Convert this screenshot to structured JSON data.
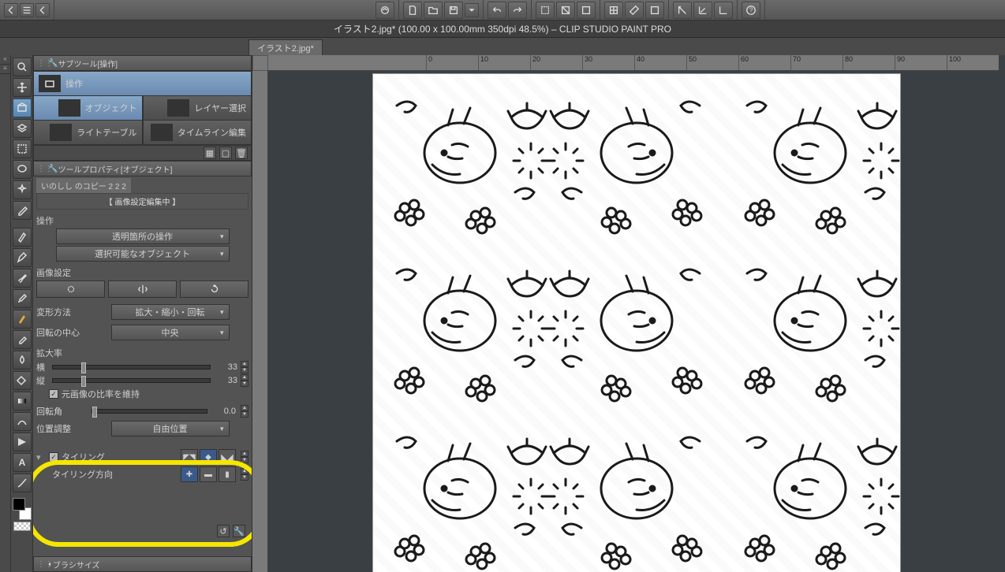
{
  "app_title": "イラスト2.jpg* (100.00 x 100.00mm 350dpi 48.5%)  –  CLIP STUDIO PAINT PRO",
  "tabs": [
    {
      "label": "イラスト2.jpg*"
    }
  ],
  "ruler_ticks": [
    "0",
    "10",
    "20",
    "30",
    "40",
    "50",
    "60",
    "70",
    "80",
    "90",
    "100"
  ],
  "subtool_panel": {
    "header": "サブツール[操作]",
    "main": "操作",
    "items": [
      "オブジェクト",
      "レイヤー選択",
      "ライトテーブル",
      "タイムライン編集"
    ]
  },
  "tool_property": {
    "header": "ツールプロパティ[オブジェクト]",
    "object_name": "いのしし のコピー 2 2 2",
    "editing_banner": "【 画像設定編集中 】",
    "operation_label": "操作",
    "transparent_op": "透明箇所の操作",
    "selectable_obj": "選択可能なオブジェクト",
    "image_settings_label": "画像設定",
    "transform_method_label": "変形方法",
    "transform_method_value": "拡大・縮小・回転",
    "rotation_center_label": "回転の中心",
    "rotation_center_value": "中央",
    "scale_label": "拡大率",
    "scale_h_label": "横",
    "scale_h_value": "33",
    "scale_v_label": "縦",
    "scale_v_value": "33",
    "maintain_ratio": "元画像の比率を維持",
    "rotation_label": "回転角",
    "rotation_value": "0.0",
    "position_label": "位置調整",
    "position_value": "自由位置",
    "tiling_label": "タイリング",
    "tiling_direction_label": "タイリング方向"
  },
  "brush_size_panel": "ブラシサイズ"
}
